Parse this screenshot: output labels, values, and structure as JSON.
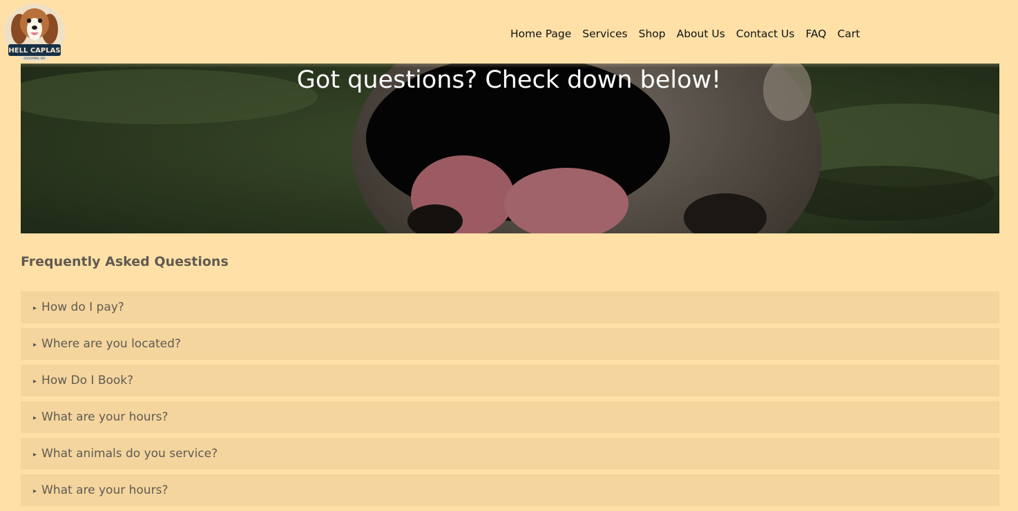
{
  "brand": {
    "logo_text": "HELL CAPLAS",
    "logo_subtext": "GROOMING SPA"
  },
  "nav": {
    "items": [
      "Home Page",
      "Services",
      "Shop",
      "About Us",
      "Contact Us",
      "FAQ",
      "Cart"
    ]
  },
  "hero": {
    "title": "Got questions? Check down below!"
  },
  "faq": {
    "heading": "Frequently Asked Questions",
    "marker": "▸",
    "items": [
      "How do I pay?",
      "Where are you located?",
      "How Do I Book?",
      "What are your hours?",
      "What animals do you service?",
      "What are your hours?"
    ]
  },
  "colors": {
    "page_bg": "#ffe1a8",
    "faq_item_bg": "#f4d59d",
    "heading_text": "#605a50"
  }
}
